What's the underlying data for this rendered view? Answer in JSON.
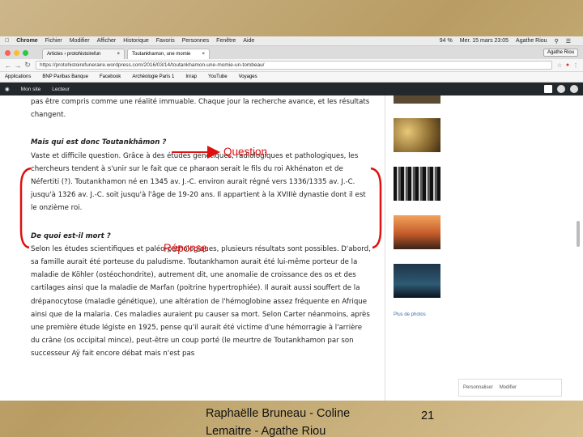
{
  "menubar": {
    "app": "Chrome",
    "items": [
      "Fichier",
      "Modifier",
      "Afficher",
      "Historique",
      "Favoris",
      "Personnes",
      "Fenêtre",
      "Aide"
    ],
    "battery": "94 %",
    "clock": "Mer. 15 mars 23:05",
    "user": "Agathe Riou"
  },
  "tabs": [
    {
      "label": "Articles ‹ protohistoirefun",
      "close": "×"
    },
    {
      "label": "Toutankhamon, une momie",
      "close": "×"
    }
  ],
  "profile_chip": "Agathe Riou",
  "url": "https://protohistoirefuneraire.wordpress.com/2016/03/14/toutankhamon-une-momie-un-tombeau/",
  "bookmarks": [
    "Applications",
    "BNP Paribas Banque",
    "Facebook",
    "Archéologie Paris 1",
    "Inrap",
    "YouTube",
    "Voyages"
  ],
  "wp_bar": {
    "site": "Mon site",
    "reader": "Lecteur"
  },
  "article": {
    "intro": "pas être compris comme une réalité immuable. Chaque jour la recherche avance, et les résultats changent.",
    "q1": "Mais qui est donc Toutankhâmon ?",
    "answer": "Vaste et difficile question. Grâce à des études génétiques, radiologiques et pathologiques, les chercheurs tendent à s'unir sur le fait que ce pharaon serait le fils du roi Akhénaton et de Néfertiti (?). Toutankhamon né en 1345 av. J.-C. environ aurait régné vers 1336/1335 av. J.-C. jusqu'à 1326 av. J.-C. soit jusqu'à l'âge de 19-20 ans. Il appartient à la XVIIIè dynastie dont il est le onzième roi.",
    "q2": "De quoi est-il mort ?",
    "body": "Selon les études scientifiques et paléo-pathologiques, plusieurs résultats sont possibles. D'abord, sa famille aurait été porteuse du paludisme. Toutankhamon aurait été lui-même porteur de la maladie de Köhler (ostéochondrite), autrement dit, une anomalie de croissance des os et des cartilages ainsi que la maladie de Marfan (poitrine hypertrophiée). Il aurait aussi souffert de la drépanocytose (maladie génétique), une altération de l'hémoglobine assez fréquente en Afrique ainsi que de la malaria. Ces maladies auraient pu causer sa mort. Selon Carter néanmoins, après une première étude légiste en 1925, pense qu'il aurait été victime d'une hémorragie à l'arrière du crâne (os occipital mince), peut-être un coup porté (le meurtre de Toutankhamon par son successeur Aÿ fait encore débat mais n'est pas"
  },
  "sidebar": {
    "more_photos": "Plus de photos"
  },
  "customize_bar": {
    "customize": "Personnaliser",
    "edit": "Modifier"
  },
  "annotations": {
    "question": "Question",
    "answer": "Réponse",
    "color": "#e01010"
  },
  "footer": {
    "authors": "Raphaëlle Bruneau - Coline Lemaitre - Agathe Riou",
    "page": "21"
  }
}
